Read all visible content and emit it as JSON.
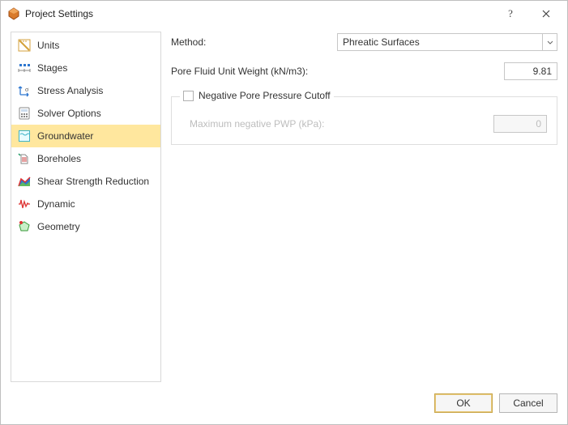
{
  "window": {
    "title": "Project Settings"
  },
  "sidebar": {
    "items": [
      {
        "label": "Units"
      },
      {
        "label": "Stages"
      },
      {
        "label": "Stress Analysis"
      },
      {
        "label": "Solver Options"
      },
      {
        "label": "Groundwater"
      },
      {
        "label": "Boreholes"
      },
      {
        "label": "Shear Strength Reduction"
      },
      {
        "label": "Dynamic"
      },
      {
        "label": "Geometry"
      }
    ],
    "selected_index": 4
  },
  "main": {
    "method_label": "Method:",
    "method_value": "Phreatic Surfaces",
    "pfuw_label": "Pore Fluid Unit Weight (kN/m3):",
    "pfuw_value": "9.81",
    "group": {
      "legend": "Negative Pore Pressure Cutoff",
      "checked": false,
      "max_label": "Maximum negative PWP (kPa):",
      "max_value": "0"
    }
  },
  "footer": {
    "ok": "OK",
    "cancel": "Cancel"
  }
}
